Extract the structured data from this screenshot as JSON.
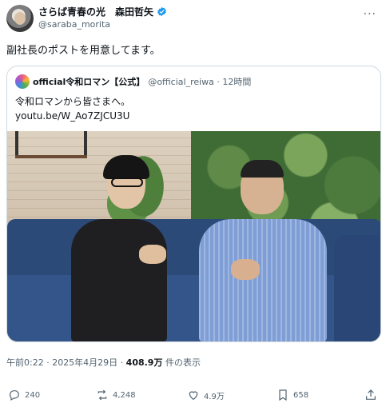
{
  "author": {
    "display_name": "さらば青春の光　森田哲矢",
    "handle": "@saraba_morita",
    "verified": true
  },
  "tweet_text": "副社長のポストを用意してます。",
  "quote": {
    "display_name": "official令和ロマン【公式】",
    "handle_time": "@official_reiwa · 12時間",
    "text": "令和ロマンから皆さまへ。",
    "link": "youtu.be/W_Ao7ZJCU3U"
  },
  "meta": {
    "timestamp": "午前0:22 · 2025年4月29日 · ",
    "views_count": "408.9万",
    "views_label": " 件の表示"
  },
  "actions": {
    "replies": "240",
    "reposts": "4,248",
    "likes": "4.9万",
    "bookmarks": "658"
  },
  "colors": {
    "text": "#0f1419",
    "secondary": "#536471",
    "border": "#cfd9de",
    "verified": "#1d9bf0"
  },
  "icons": [
    "more-icon",
    "verified-icon",
    "reply-icon",
    "repost-icon",
    "like-icon",
    "bookmark-icon",
    "share-icon"
  ]
}
